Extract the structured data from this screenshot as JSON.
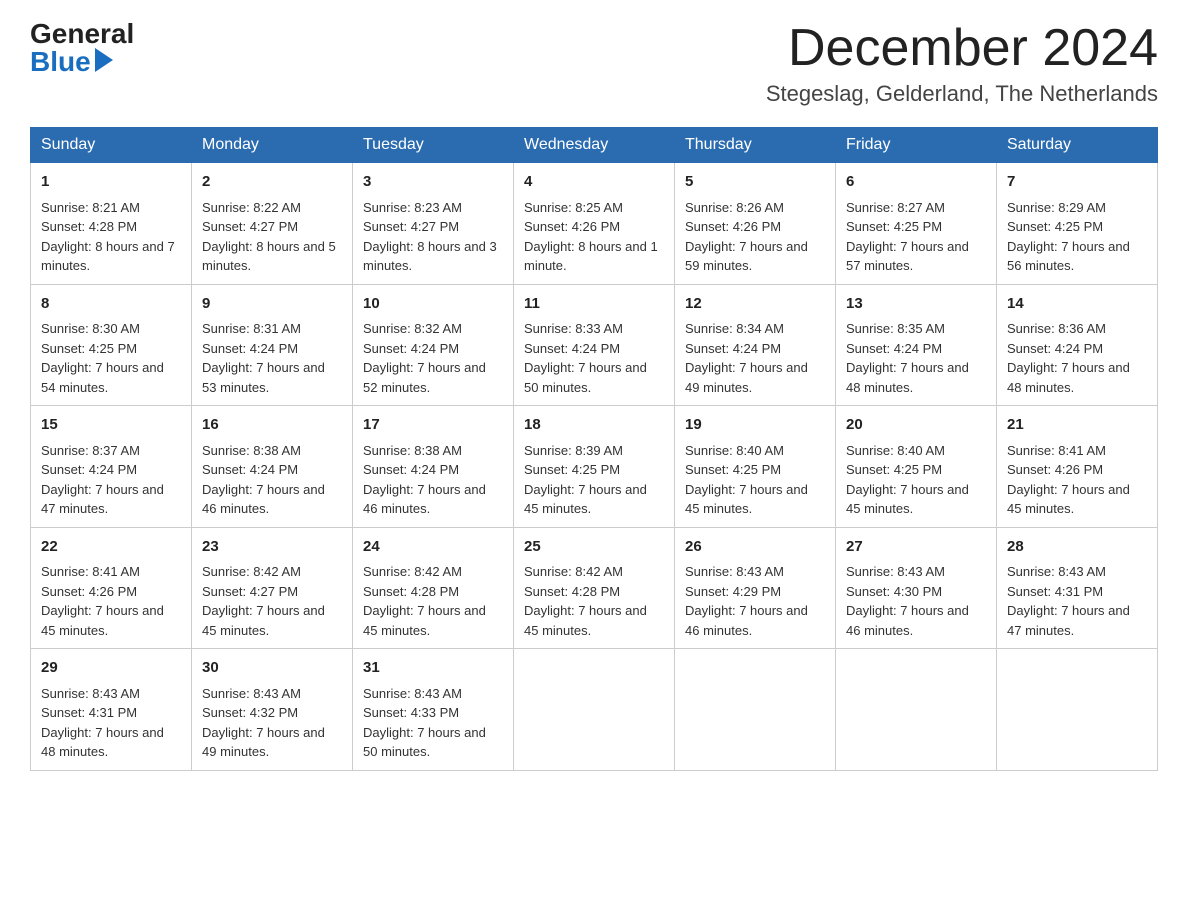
{
  "header": {
    "logo_general": "General",
    "logo_blue": "Blue",
    "month_title": "December 2024",
    "location": "Stegeslag, Gelderland, The Netherlands"
  },
  "weekdays": [
    "Sunday",
    "Monday",
    "Tuesday",
    "Wednesday",
    "Thursday",
    "Friday",
    "Saturday"
  ],
  "weeks": [
    [
      {
        "day": "1",
        "sunrise": "8:21 AM",
        "sunset": "4:28 PM",
        "daylight": "8 hours and 7 minutes."
      },
      {
        "day": "2",
        "sunrise": "8:22 AM",
        "sunset": "4:27 PM",
        "daylight": "8 hours and 5 minutes."
      },
      {
        "day": "3",
        "sunrise": "8:23 AM",
        "sunset": "4:27 PM",
        "daylight": "8 hours and 3 minutes."
      },
      {
        "day": "4",
        "sunrise": "8:25 AM",
        "sunset": "4:26 PM",
        "daylight": "8 hours and 1 minute."
      },
      {
        "day": "5",
        "sunrise": "8:26 AM",
        "sunset": "4:26 PM",
        "daylight": "7 hours and 59 minutes."
      },
      {
        "day": "6",
        "sunrise": "8:27 AM",
        "sunset": "4:25 PM",
        "daylight": "7 hours and 57 minutes."
      },
      {
        "day": "7",
        "sunrise": "8:29 AM",
        "sunset": "4:25 PM",
        "daylight": "7 hours and 56 minutes."
      }
    ],
    [
      {
        "day": "8",
        "sunrise": "8:30 AM",
        "sunset": "4:25 PM",
        "daylight": "7 hours and 54 minutes."
      },
      {
        "day": "9",
        "sunrise": "8:31 AM",
        "sunset": "4:24 PM",
        "daylight": "7 hours and 53 minutes."
      },
      {
        "day": "10",
        "sunrise": "8:32 AM",
        "sunset": "4:24 PM",
        "daylight": "7 hours and 52 minutes."
      },
      {
        "day": "11",
        "sunrise": "8:33 AM",
        "sunset": "4:24 PM",
        "daylight": "7 hours and 50 minutes."
      },
      {
        "day": "12",
        "sunrise": "8:34 AM",
        "sunset": "4:24 PM",
        "daylight": "7 hours and 49 minutes."
      },
      {
        "day": "13",
        "sunrise": "8:35 AM",
        "sunset": "4:24 PM",
        "daylight": "7 hours and 48 minutes."
      },
      {
        "day": "14",
        "sunrise": "8:36 AM",
        "sunset": "4:24 PM",
        "daylight": "7 hours and 48 minutes."
      }
    ],
    [
      {
        "day": "15",
        "sunrise": "8:37 AM",
        "sunset": "4:24 PM",
        "daylight": "7 hours and 47 minutes."
      },
      {
        "day": "16",
        "sunrise": "8:38 AM",
        "sunset": "4:24 PM",
        "daylight": "7 hours and 46 minutes."
      },
      {
        "day": "17",
        "sunrise": "8:38 AM",
        "sunset": "4:24 PM",
        "daylight": "7 hours and 46 minutes."
      },
      {
        "day": "18",
        "sunrise": "8:39 AM",
        "sunset": "4:25 PM",
        "daylight": "7 hours and 45 minutes."
      },
      {
        "day": "19",
        "sunrise": "8:40 AM",
        "sunset": "4:25 PM",
        "daylight": "7 hours and 45 minutes."
      },
      {
        "day": "20",
        "sunrise": "8:40 AM",
        "sunset": "4:25 PM",
        "daylight": "7 hours and 45 minutes."
      },
      {
        "day": "21",
        "sunrise": "8:41 AM",
        "sunset": "4:26 PM",
        "daylight": "7 hours and 45 minutes."
      }
    ],
    [
      {
        "day": "22",
        "sunrise": "8:41 AM",
        "sunset": "4:26 PM",
        "daylight": "7 hours and 45 minutes."
      },
      {
        "day": "23",
        "sunrise": "8:42 AM",
        "sunset": "4:27 PM",
        "daylight": "7 hours and 45 minutes."
      },
      {
        "day": "24",
        "sunrise": "8:42 AM",
        "sunset": "4:28 PM",
        "daylight": "7 hours and 45 minutes."
      },
      {
        "day": "25",
        "sunrise": "8:42 AM",
        "sunset": "4:28 PM",
        "daylight": "7 hours and 45 minutes."
      },
      {
        "day": "26",
        "sunrise": "8:43 AM",
        "sunset": "4:29 PM",
        "daylight": "7 hours and 46 minutes."
      },
      {
        "day": "27",
        "sunrise": "8:43 AM",
        "sunset": "4:30 PM",
        "daylight": "7 hours and 46 minutes."
      },
      {
        "day": "28",
        "sunrise": "8:43 AM",
        "sunset": "4:31 PM",
        "daylight": "7 hours and 47 minutes."
      }
    ],
    [
      {
        "day": "29",
        "sunrise": "8:43 AM",
        "sunset": "4:31 PM",
        "daylight": "7 hours and 48 minutes."
      },
      {
        "day": "30",
        "sunrise": "8:43 AM",
        "sunset": "4:32 PM",
        "daylight": "7 hours and 49 minutes."
      },
      {
        "day": "31",
        "sunrise": "8:43 AM",
        "sunset": "4:33 PM",
        "daylight": "7 hours and 50 minutes."
      },
      null,
      null,
      null,
      null
    ]
  ]
}
